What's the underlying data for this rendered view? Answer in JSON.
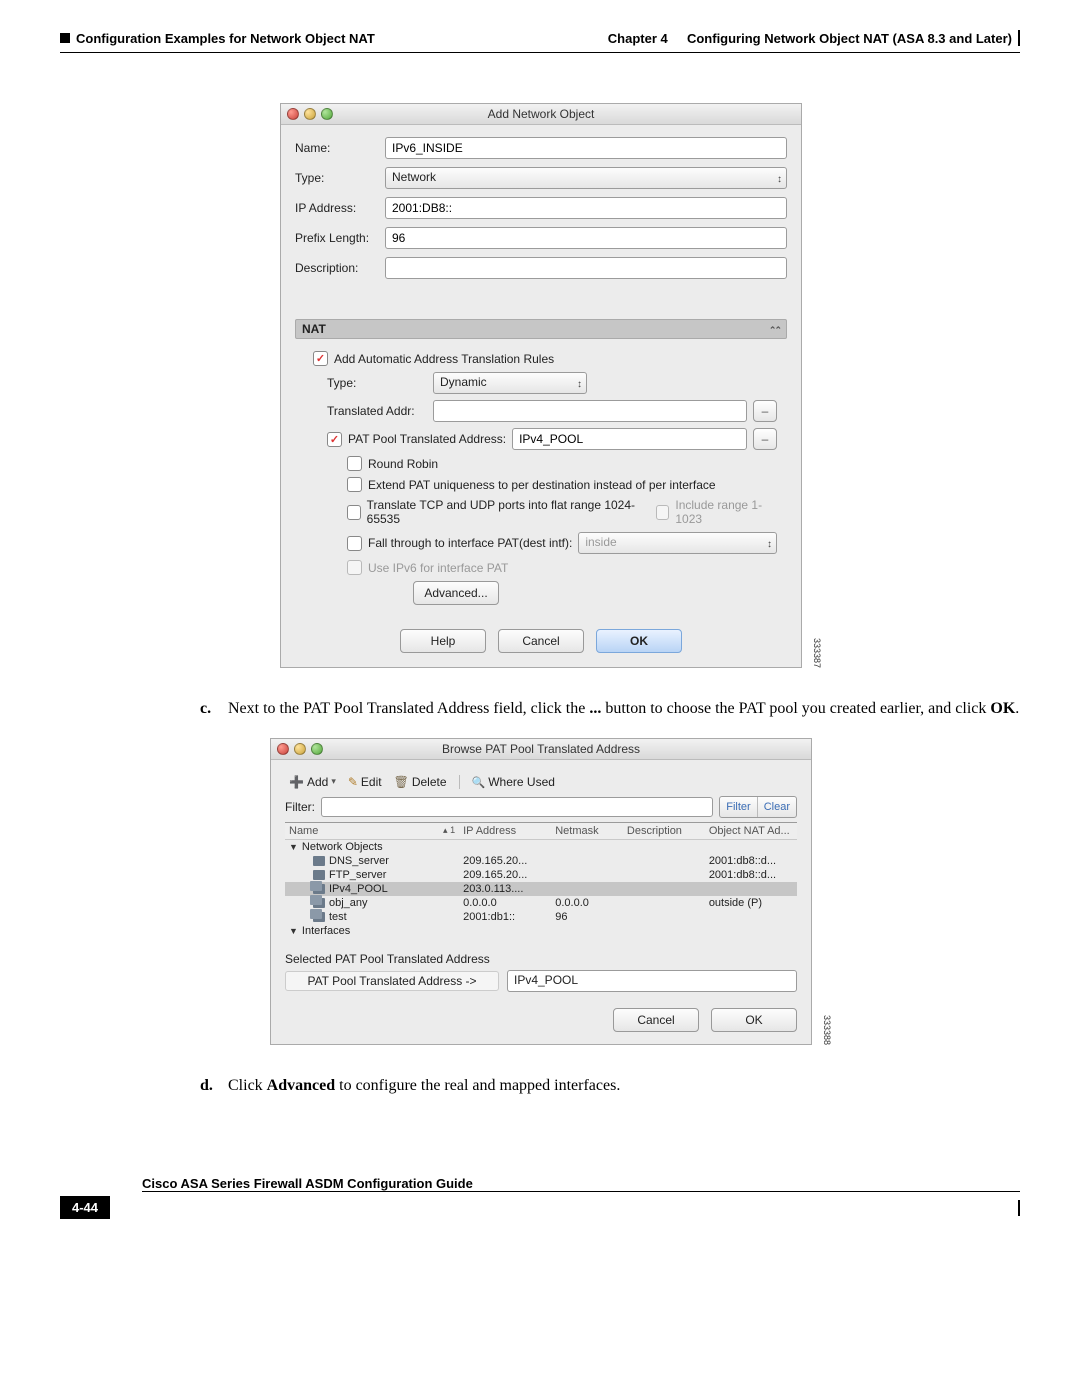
{
  "header": {
    "chapter": "Chapter 4",
    "chapter_title": "Configuring Network Object NAT (ASA 8.3 and Later)",
    "section": "Configuration Examples for Network Object NAT"
  },
  "dialog1": {
    "title": "Add Network Object",
    "labels": {
      "name": "Name:",
      "type": "Type:",
      "ip": "IP Address:",
      "prefix": "Prefix Length:",
      "desc": "Description:"
    },
    "values": {
      "name": "IPv6_INSIDE",
      "type": "Network",
      "ip": "2001:DB8::",
      "prefix": "96",
      "desc": ""
    },
    "nat": {
      "section_title": "NAT",
      "add_auto": "Add Automatic Address Translation Rules",
      "type_label": "Type:",
      "type_value": "Dynamic",
      "trans_label": "Translated Addr:",
      "trans_value": "",
      "pat_pool_label": "PAT Pool Translated Address:",
      "pat_pool_value": "IPv4_POOL",
      "round_robin": "Round Robin",
      "extend_pat": "Extend PAT uniqueness to per destination instead of per interface",
      "translate_flat": "Translate TCP and UDP ports into flat range 1024-65535",
      "include_range": "Include range 1-1023",
      "fall_through": "Fall through to interface PAT(dest intf):",
      "fall_value": "inside",
      "use_ipv6": "Use IPv6 for interface PAT",
      "advanced": "Advanced...",
      "help": "Help",
      "cancel": "Cancel",
      "ok": "OK"
    },
    "side_code": "333387"
  },
  "step_c": {
    "marker": "c.",
    "pre": "Next to the PAT Pool Translated Address field, click the ",
    "bold1": "...",
    "mid": " button to choose the PAT pool you created earlier, and click ",
    "bold2": "OK",
    "post": "."
  },
  "dialog2": {
    "title": "Browse PAT Pool Translated Address",
    "toolbar": {
      "add": "Add",
      "edit": "Edit",
      "delete": "Delete",
      "where": "Where Used"
    },
    "filter_label": "Filter:",
    "filter_btn_l": "Filter",
    "filter_btn_r": "Clear",
    "columns": {
      "name": "Name",
      "ip": "IP Address",
      "sort": "1",
      "netmask": "Netmask",
      "desc": "Description",
      "nat": "Object NAT Ad..."
    },
    "cat1": "Network Objects",
    "rows": [
      {
        "name": "DNS_server",
        "ip": "209.165.20...",
        "mask": "",
        "desc": "",
        "nat": "2001:db8::d...",
        "icon": "single"
      },
      {
        "name": "FTP_server",
        "ip": "209.165.20...",
        "mask": "",
        "desc": "",
        "nat": "2001:db8::d...",
        "icon": "single"
      },
      {
        "name": "IPv4_POOL",
        "ip": "203.0.113....",
        "mask": "",
        "desc": "",
        "nat": "",
        "icon": "group",
        "selected": true
      },
      {
        "name": "obj_any",
        "ip": "0.0.0.0",
        "mask": "0.0.0.0",
        "desc": "",
        "nat": "outside (P)",
        "icon": "group"
      },
      {
        "name": "test",
        "ip": "2001:db1::",
        "mask": "96",
        "desc": "",
        "nat": "",
        "icon": "group"
      }
    ],
    "cat2": "Interfaces",
    "selected_heading": "Selected PAT Pool Translated Address",
    "selected_label": "PAT Pool Translated Address ->",
    "selected_value": "IPv4_POOL",
    "cancel": "Cancel",
    "ok": "OK",
    "side_code": "333388"
  },
  "step_d": {
    "marker": "d.",
    "pre": "Click ",
    "bold": "Advanced",
    "post": " to configure the real and mapped interfaces."
  },
  "footer": {
    "guide": "Cisco ASA Series Firewall ASDM Configuration Guide",
    "page": "4-44"
  }
}
